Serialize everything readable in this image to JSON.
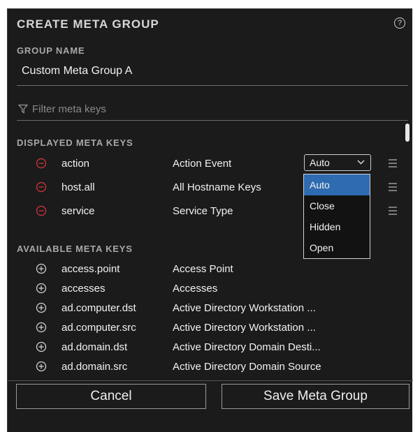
{
  "dialog": {
    "title": "CREATE META GROUP",
    "help_icon": "question-circle-icon"
  },
  "group_name": {
    "label": "GROUP NAME",
    "value": "Custom Meta Group A"
  },
  "filter": {
    "placeholder": "Filter meta keys",
    "icon": "filter-icon"
  },
  "displayed": {
    "label": "DISPLAYED META KEYS",
    "rows": [
      {
        "key": "action",
        "description": "Action Event"
      },
      {
        "key": "host.all",
        "description": "All Hostname Keys"
      },
      {
        "key": "service",
        "description": "Service Type"
      }
    ],
    "select": {
      "value": "Auto",
      "options": [
        "Auto",
        "Close",
        "Hidden",
        "Open"
      ],
      "highlighted": "Auto"
    }
  },
  "available": {
    "label": "AVAILABLE META KEYS",
    "rows": [
      {
        "key": "access.point",
        "description": "Access Point"
      },
      {
        "key": "accesses",
        "description": "Accesses"
      },
      {
        "key": "ad.computer.dst",
        "description": "Active Directory Workstation ..."
      },
      {
        "key": "ad.computer.src",
        "description": "Active Directory Workstation ..."
      },
      {
        "key": "ad.domain.dst",
        "description": "Active Directory Domain Desti..."
      },
      {
        "key": "ad.domain.src",
        "description": "Active Directory Domain Source"
      }
    ]
  },
  "footer": {
    "cancel_label": "Cancel",
    "save_label": "Save Meta Group"
  },
  "colors": {
    "background": "#1b1b1b",
    "remove_icon": "#c0333a",
    "selected_option": "#2e6bb0"
  }
}
